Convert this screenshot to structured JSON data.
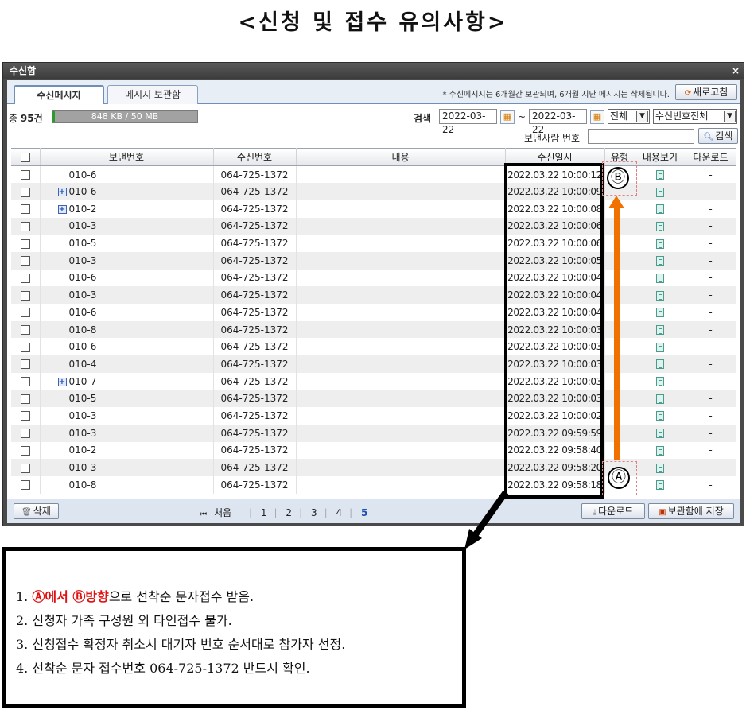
{
  "page_title": "<신청 및 접수 유의사항>",
  "window": {
    "title": "수신함",
    "close_glyph": "×"
  },
  "tabs": [
    {
      "label": "수신메시지",
      "active": true
    },
    {
      "label": "메시지 보관함",
      "active": false
    }
  ],
  "notice": "* 수신메시지는 6개월간 보관되며, 6개월 지난 메시지는 삭제됩니다.",
  "refresh_button": "새로고침",
  "summary": {
    "total_label": "총",
    "total_count": "95건",
    "storage_text": "848 KB / 50 MB",
    "storage_fraction": 0.017
  },
  "search": {
    "label": "검색",
    "date_from": "2022-03-22",
    "tilde": "~",
    "date_to": "2022-03-22",
    "type_select": "전체",
    "field_select": "수신번호전체",
    "sender_label": "보낸사람 번호",
    "sender_value": "",
    "search_button": "검색"
  },
  "table": {
    "columns": [
      "",
      "보낸번호",
      "수신번호",
      "내용",
      "수신일시",
      "유형",
      "내용보기",
      "다운로드"
    ],
    "rows": [
      {
        "sender": "010-6",
        "expand": false,
        "receiver": "064-725-1372",
        "datetime": "2022.03.22 10:00:12",
        "download": "-"
      },
      {
        "sender": "010-6",
        "expand": true,
        "receiver": "064-725-1372",
        "datetime": "2022.03.22 10:00:09",
        "download": "-"
      },
      {
        "sender": "010-2",
        "expand": true,
        "receiver": "064-725-1372",
        "datetime": "2022.03.22 10:00:08",
        "download": "-"
      },
      {
        "sender": "010-3",
        "expand": false,
        "receiver": "064-725-1372",
        "datetime": "2022.03.22 10:00:06",
        "download": "-"
      },
      {
        "sender": "010-5",
        "expand": false,
        "receiver": "064-725-1372",
        "datetime": "2022.03.22 10:00:06",
        "download": "-"
      },
      {
        "sender": "010-3",
        "expand": false,
        "receiver": "064-725-1372",
        "datetime": "2022.03.22 10:00:05",
        "download": "-"
      },
      {
        "sender": "010-6",
        "expand": false,
        "receiver": "064-725-1372",
        "datetime": "2022.03.22 10:00:04",
        "download": "-"
      },
      {
        "sender": "010-3",
        "expand": false,
        "receiver": "064-725-1372",
        "datetime": "2022.03.22 10:00:04",
        "download": "-"
      },
      {
        "sender": "010-6",
        "expand": false,
        "receiver": "064-725-1372",
        "datetime": "2022.03.22 10:00:04",
        "download": "-"
      },
      {
        "sender": "010-8",
        "expand": false,
        "receiver": "064-725-1372",
        "datetime": "2022.03.22 10:00:03",
        "download": "-"
      },
      {
        "sender": "010-6",
        "expand": false,
        "receiver": "064-725-1372",
        "datetime": "2022.03.22 10:00:03",
        "download": "-"
      },
      {
        "sender": "010-4",
        "expand": false,
        "receiver": "064-725-1372",
        "datetime": "2022.03.22 10:00:03",
        "download": "-"
      },
      {
        "sender": "010-7",
        "expand": true,
        "receiver": "064-725-1372",
        "datetime": "2022.03.22 10:00:03",
        "download": "-"
      },
      {
        "sender": "010-5",
        "expand": false,
        "receiver": "064-725-1372",
        "datetime": "2022.03.22 10:00:03",
        "download": "-"
      },
      {
        "sender": "010-3",
        "expand": false,
        "receiver": "064-725-1372",
        "datetime": "2022.03.22 10:00:02",
        "download": "-"
      },
      {
        "sender": "010-3",
        "expand": false,
        "receiver": "064-725-1372",
        "datetime": "2022.03.22 09:59:59",
        "download": "-"
      },
      {
        "sender": "010-2",
        "expand": false,
        "receiver": "064-725-1372",
        "datetime": "2022.03.22 09:58:40",
        "download": "-"
      },
      {
        "sender": "010-3",
        "expand": false,
        "receiver": "064-725-1372",
        "datetime": "2022.03.22 09:58:20",
        "download": "-"
      },
      {
        "sender": "010-8",
        "expand": false,
        "receiver": "064-725-1372",
        "datetime": "2022.03.22 09:58:18",
        "download": "-"
      }
    ]
  },
  "bottom": {
    "delete_button": "삭제",
    "first_label": "처음",
    "pages": [
      "1",
      "2",
      "3",
      "4",
      "5"
    ],
    "current_page": "5",
    "download_button": "다운로드",
    "save_button": "보관함에 저장"
  },
  "annotations": {
    "marker_a": "Ⓐ",
    "marker_b": "Ⓑ",
    "arrow_color": "#f07000"
  },
  "notes": {
    "line1_prefix": "1. ",
    "line1_red": "Ⓐ에서 Ⓑ방향",
    "line1_rest": "으로 선착순 문자접수 받음.",
    "line2": "2. 신청자 가족 구성원 외 타인접수 불가.",
    "line3": "3. 신청접수 확정자 취소시 대기자 번호 순서대로 참가자 선정.",
    "line4": "4. 선착순 문자 접수번호 064-725-1372 반드시 확인."
  }
}
